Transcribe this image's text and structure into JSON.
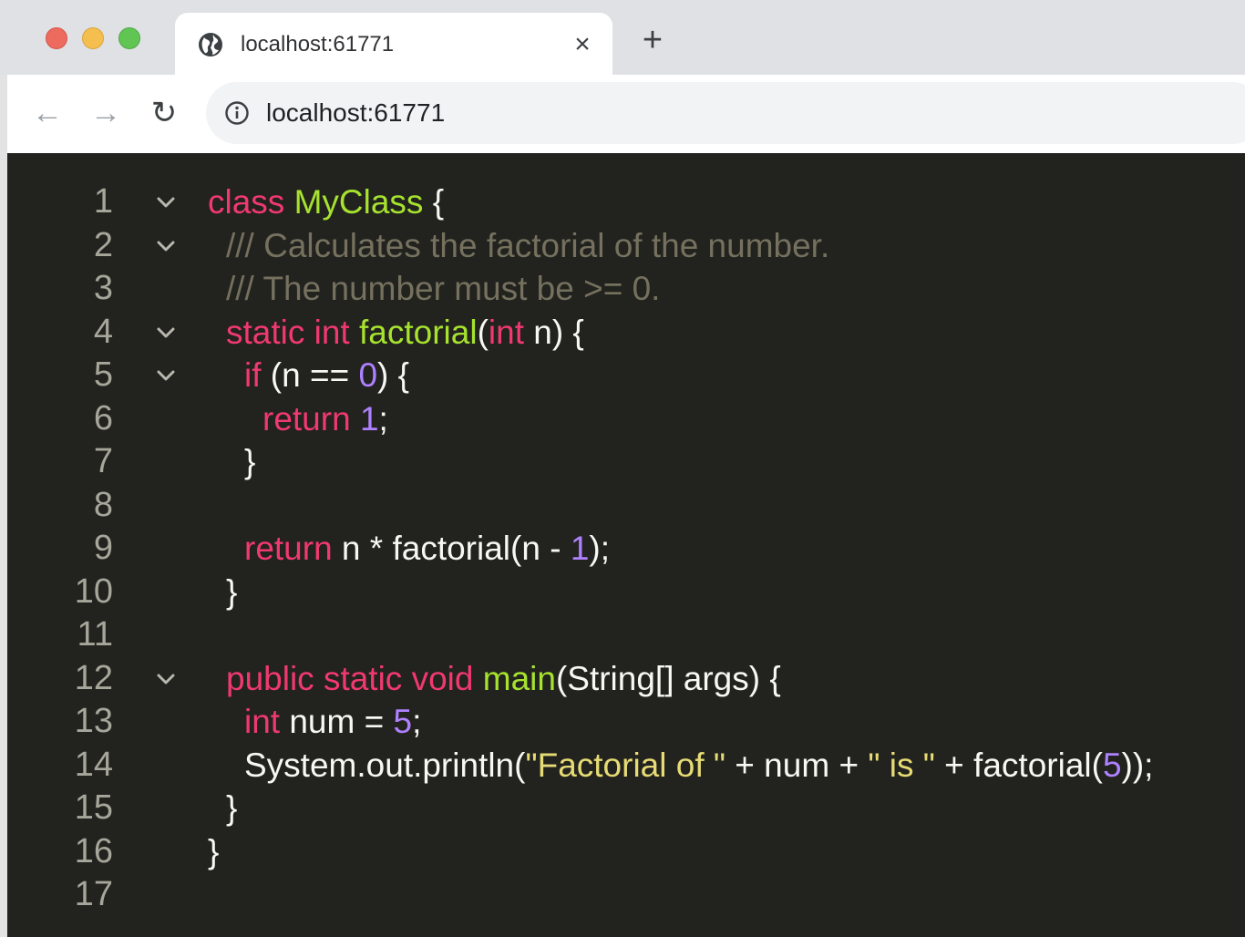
{
  "browser": {
    "tab_title": "localhost:61771",
    "tab_close": "×",
    "new_tab": "+",
    "url": "localhost:61771",
    "back": "←",
    "forward": "→",
    "reload": "↻"
  },
  "editor": {
    "lines": [
      {
        "n": "1",
        "fold": true,
        "indent": 0,
        "tokens": [
          [
            "keyword",
            "class "
          ],
          [
            "class",
            "MyClass"
          ],
          [
            "plain",
            " {"
          ]
        ]
      },
      {
        "n": "2",
        "fold": true,
        "indent": 1,
        "tokens": [
          [
            "comment",
            "/// Calculates the factorial of the number."
          ]
        ]
      },
      {
        "n": "3",
        "fold": false,
        "indent": 1,
        "tokens": [
          [
            "comment",
            "/// The number must be >= 0."
          ]
        ]
      },
      {
        "n": "4",
        "fold": true,
        "indent": 1,
        "tokens": [
          [
            "keyword",
            "static int "
          ],
          [
            "func",
            "factorial"
          ],
          [
            "plain",
            "("
          ],
          [
            "keyword",
            "int"
          ],
          [
            "plain",
            " n) {"
          ]
        ]
      },
      {
        "n": "5",
        "fold": true,
        "indent": 2,
        "tokens": [
          [
            "keyword",
            "if"
          ],
          [
            "plain",
            " (n == "
          ],
          [
            "number",
            "0"
          ],
          [
            "plain",
            ") {"
          ]
        ]
      },
      {
        "n": "6",
        "fold": false,
        "indent": 3,
        "tokens": [
          [
            "keyword",
            "return "
          ],
          [
            "number",
            "1"
          ],
          [
            "plain",
            ";"
          ]
        ]
      },
      {
        "n": "7",
        "fold": false,
        "indent": 2,
        "tokens": [
          [
            "plain",
            "}"
          ]
        ]
      },
      {
        "n": "8",
        "fold": false,
        "indent": 0,
        "tokens": []
      },
      {
        "n": "9",
        "fold": false,
        "indent": 2,
        "tokens": [
          [
            "keyword",
            "return"
          ],
          [
            "plain",
            " n * factorial(n - "
          ],
          [
            "number",
            "1"
          ],
          [
            "plain",
            ");"
          ]
        ]
      },
      {
        "n": "10",
        "fold": false,
        "indent": 1,
        "tokens": [
          [
            "plain",
            "}"
          ]
        ]
      },
      {
        "n": "11",
        "fold": false,
        "indent": 0,
        "tokens": []
      },
      {
        "n": "12",
        "fold": true,
        "indent": 1,
        "tokens": [
          [
            "keyword",
            "public static void "
          ],
          [
            "func",
            "main"
          ],
          [
            "plain",
            "(String[] args) {"
          ]
        ]
      },
      {
        "n": "13",
        "fold": false,
        "indent": 2,
        "tokens": [
          [
            "keyword",
            "int"
          ],
          [
            "plain",
            " num = "
          ],
          [
            "number",
            "5"
          ],
          [
            "plain",
            ";"
          ]
        ]
      },
      {
        "n": "14",
        "fold": false,
        "indent": 2,
        "tokens": [
          [
            "plain",
            "System.out.println("
          ],
          [
            "string",
            "\"Factorial of \""
          ],
          [
            "plain",
            " + num + "
          ],
          [
            "string",
            "\" is \""
          ],
          [
            "plain",
            " + factorial("
          ],
          [
            "number",
            "5"
          ],
          [
            "plain",
            "));"
          ]
        ]
      },
      {
        "n": "15",
        "fold": false,
        "indent": 1,
        "tokens": [
          [
            "plain",
            "}"
          ]
        ]
      },
      {
        "n": "16",
        "fold": false,
        "indent": 0,
        "tokens": [
          [
            "plain",
            "}"
          ]
        ]
      },
      {
        "n": "17",
        "fold": false,
        "indent": 0,
        "tokens": []
      }
    ]
  },
  "colors": {
    "editor_bg": "#22221f",
    "keyword": "#f0396f",
    "class_name": "#a6e22e",
    "number": "#ae81ff",
    "string": "#e6db74",
    "comment": "#75715e",
    "gutter_text": "#a6a69a"
  },
  "icons": [
    "globe-icon",
    "close-icon",
    "plus-icon",
    "back-arrow-icon",
    "forward-arrow-icon",
    "reload-icon",
    "info-icon",
    "chevron-down-icon"
  ]
}
